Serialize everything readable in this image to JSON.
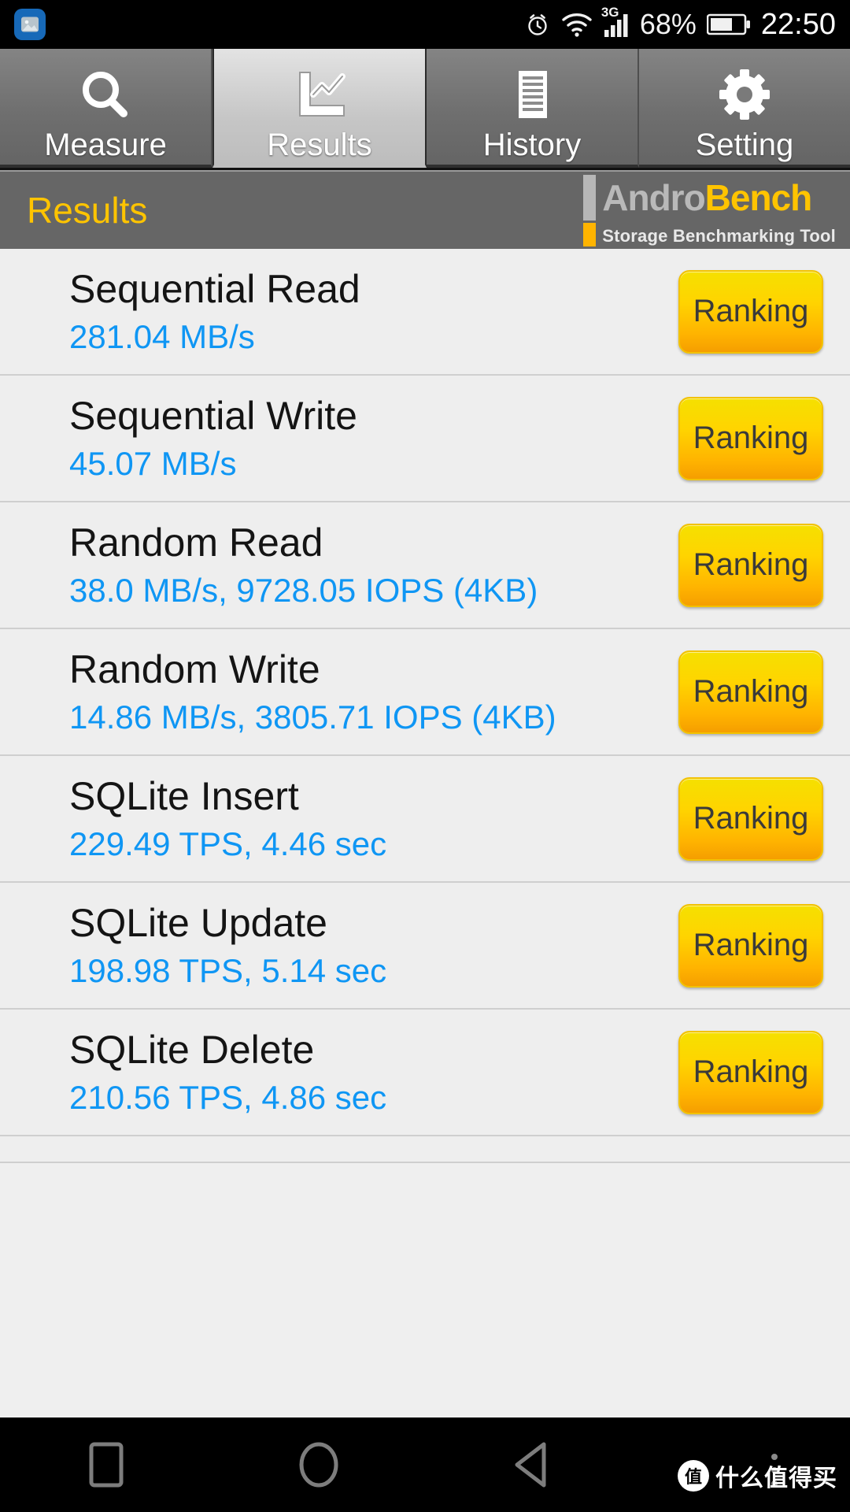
{
  "statusbar": {
    "notification_icon": "gallery-icon",
    "alarm_icon": "alarm-clock-icon",
    "wifi_icon": "wifi-icon",
    "network_label": "3G",
    "signal_icon": "signal-bars-icon",
    "battery_percent": "68%",
    "battery_icon": "battery-icon",
    "clock": "22:50"
  },
  "tabs": [
    {
      "label": "Measure",
      "icon": "magnifier-icon",
      "active": false
    },
    {
      "label": "Results",
      "icon": "line-chart-icon",
      "active": true
    },
    {
      "label": "History",
      "icon": "document-lines-icon",
      "active": false
    },
    {
      "label": "Setting",
      "icon": "gear-icon",
      "active": false
    }
  ],
  "header": {
    "title": "Results",
    "logo_andro": "Andro",
    "logo_bench": "Bench",
    "logo_subtitle": "Storage Benchmarking Tool"
  },
  "results": [
    {
      "title": "Sequential Read",
      "value": "281.04 MB/s",
      "button": "Ranking"
    },
    {
      "title": "Sequential Write",
      "value": "45.07 MB/s",
      "button": "Ranking"
    },
    {
      "title": "Random Read",
      "value": "38.0 MB/s, 9728.05 IOPS (4KB)",
      "button": "Ranking"
    },
    {
      "title": "Random Write",
      "value": "14.86 MB/s, 3805.71 IOPS (4KB)",
      "button": "Ranking"
    },
    {
      "title": "SQLite Insert",
      "value": "229.49 TPS, 4.46 sec",
      "button": "Ranking"
    },
    {
      "title": "SQLite Update",
      "value": "198.98 TPS, 5.14 sec",
      "button": "Ranking"
    },
    {
      "title": "SQLite Delete",
      "value": "210.56 TPS, 4.86 sec",
      "button": "Ranking"
    }
  ],
  "navbar": {
    "recent_icon": "square-recents-icon",
    "home_icon": "circle-home-icon",
    "back_icon": "triangle-back-icon",
    "menu_icon": "more-vertical-icon",
    "watermark_badge": "值",
    "watermark_text": "什么值得买"
  },
  "colors": {
    "accent_yellow": "#ffc400",
    "value_blue": "#0f96f4",
    "header_gray": "#666666",
    "list_bg": "#eeeeee"
  }
}
